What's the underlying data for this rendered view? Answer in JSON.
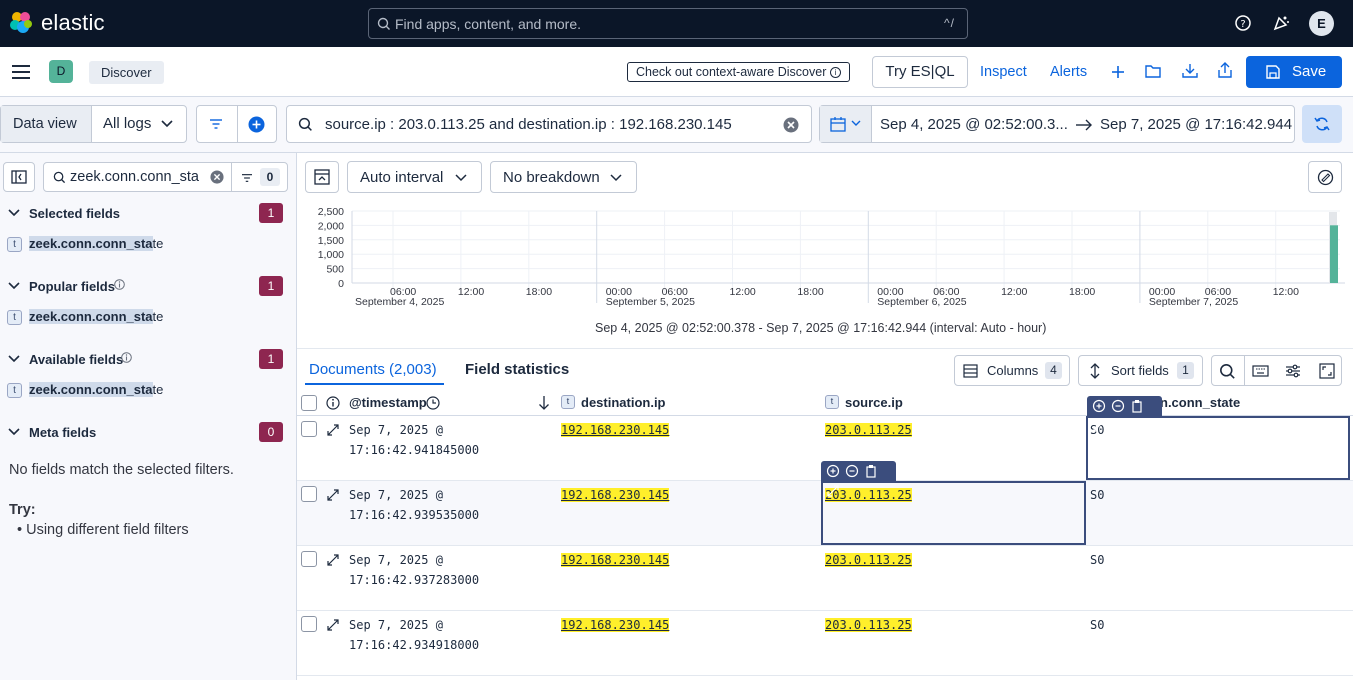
{
  "topbar": {
    "brand": "elastic",
    "search_placeholder": "Find apps, content, and more.",
    "search_shortcut": "^/",
    "avatar_initial": "E"
  },
  "header": {
    "space_initial": "D",
    "breadcrumb": "Discover",
    "context_aware_label": "Check out context-aware Discover",
    "try_esql_label": "Try ES|QL",
    "inspect_label": "Inspect",
    "alerts_label": "Alerts",
    "save_label": "Save"
  },
  "querybar": {
    "data_view_label": "Data view",
    "data_view_value": "All logs",
    "query": "source.ip : 203.0.113.25 and destination.ip : 192.168.230.145",
    "date_start": "Sep 4, 2025 @ 02:52:00.3...",
    "date_end": "Sep 7, 2025 @ 17:16:42.944"
  },
  "sidebar": {
    "field_search_value": "zeek.conn.conn_sta",
    "filter_count": "0",
    "sections": [
      {
        "title": "Selected fields",
        "count": "1",
        "field_type": "t",
        "field_match": "zeek.conn.conn_sta",
        "field_rest": "te"
      },
      {
        "title": "Popular fields",
        "count": "1",
        "field_type": "t",
        "field_match": "zeek.conn.conn_sta",
        "field_rest": "te"
      },
      {
        "title": "Available fields",
        "count": "1",
        "field_type": "t",
        "field_match": "zeek.conn.conn_sta",
        "field_rest": "te"
      },
      {
        "title": "Meta fields",
        "count": "0"
      }
    ],
    "no_fields_msg": "No fields match the selected filters.",
    "try_label": "Try:",
    "try_item": "Using different field filters"
  },
  "chart_toolbar": {
    "interval_label": "Auto interval",
    "breakdown_label": "No breakdown"
  },
  "chart_data": {
    "type": "bar",
    "y_ticks": [
      "2,500",
      "2,000",
      "1,500",
      "1,000",
      "500",
      "0"
    ],
    "ylim": [
      0,
      2500
    ],
    "x_ticks": [
      {
        "label": "06:00",
        "sub": "September 4, 2025"
      },
      {
        "label": "12:00",
        "sub": ""
      },
      {
        "label": "18:00",
        "sub": ""
      },
      {
        "label": "00:00",
        "sub": "September 5, 2025"
      },
      {
        "label": "06:00",
        "sub": ""
      },
      {
        "label": "12:00",
        "sub": ""
      },
      {
        "label": "18:00",
        "sub": ""
      },
      {
        "label": "00:00",
        "sub": "September 6, 2025"
      },
      {
        "label": "06:00",
        "sub": ""
      },
      {
        "label": "12:00",
        "sub": ""
      },
      {
        "label": "18:00",
        "sub": ""
      },
      {
        "label": "00:00",
        "sub": "September 7, 2025"
      },
      {
        "label": "06:00",
        "sub": ""
      },
      {
        "label": "12:00",
        "sub": ""
      }
    ],
    "bars": [
      {
        "x": "Sep 7, 2025 17:00",
        "value": 2003
      }
    ],
    "caption": "Sep 4, 2025 @ 02:52:00.378 - Sep 7, 2025 @ 17:16:42.944 (interval: Auto - hour)",
    "bar_color": "#54b399"
  },
  "tabs": {
    "documents": "Documents (2,003)",
    "field_statistics": "Field statistics"
  },
  "grid_toolbar": {
    "columns_label": "Columns",
    "columns_count": "4",
    "sort_label": "Sort fields",
    "sort_count": "1"
  },
  "grid": {
    "columns": {
      "timestamp": "@timestamp",
      "destination": "destination.ip",
      "source": "source.ip",
      "conn_state": "n.conn_state"
    },
    "col_type": "t",
    "rows": [
      {
        "date": "Sep 7, 2025 @",
        "time": "17:16:42.941845000",
        "destination_ip": "192.168.230.145",
        "source_ip": "203.0.113.25",
        "conn_state": "S0"
      },
      {
        "date": "Sep 7, 2025 @",
        "time": "17:16:42.939535000",
        "destination_ip": "192.168.230.145",
        "source_ip": "203.0.113.25",
        "conn_state": "S0"
      },
      {
        "date": "Sep 7, 2025 @",
        "time": "17:16:42.937283000",
        "destination_ip": "192.168.230.145",
        "source_ip": "203.0.113.25",
        "conn_state": "S0"
      },
      {
        "date": "Sep 7, 2025 @",
        "time": "17:16:42.934918000",
        "destination_ip": "192.168.230.145",
        "source_ip": "203.0.113.25",
        "conn_state": "S0"
      }
    ]
  }
}
